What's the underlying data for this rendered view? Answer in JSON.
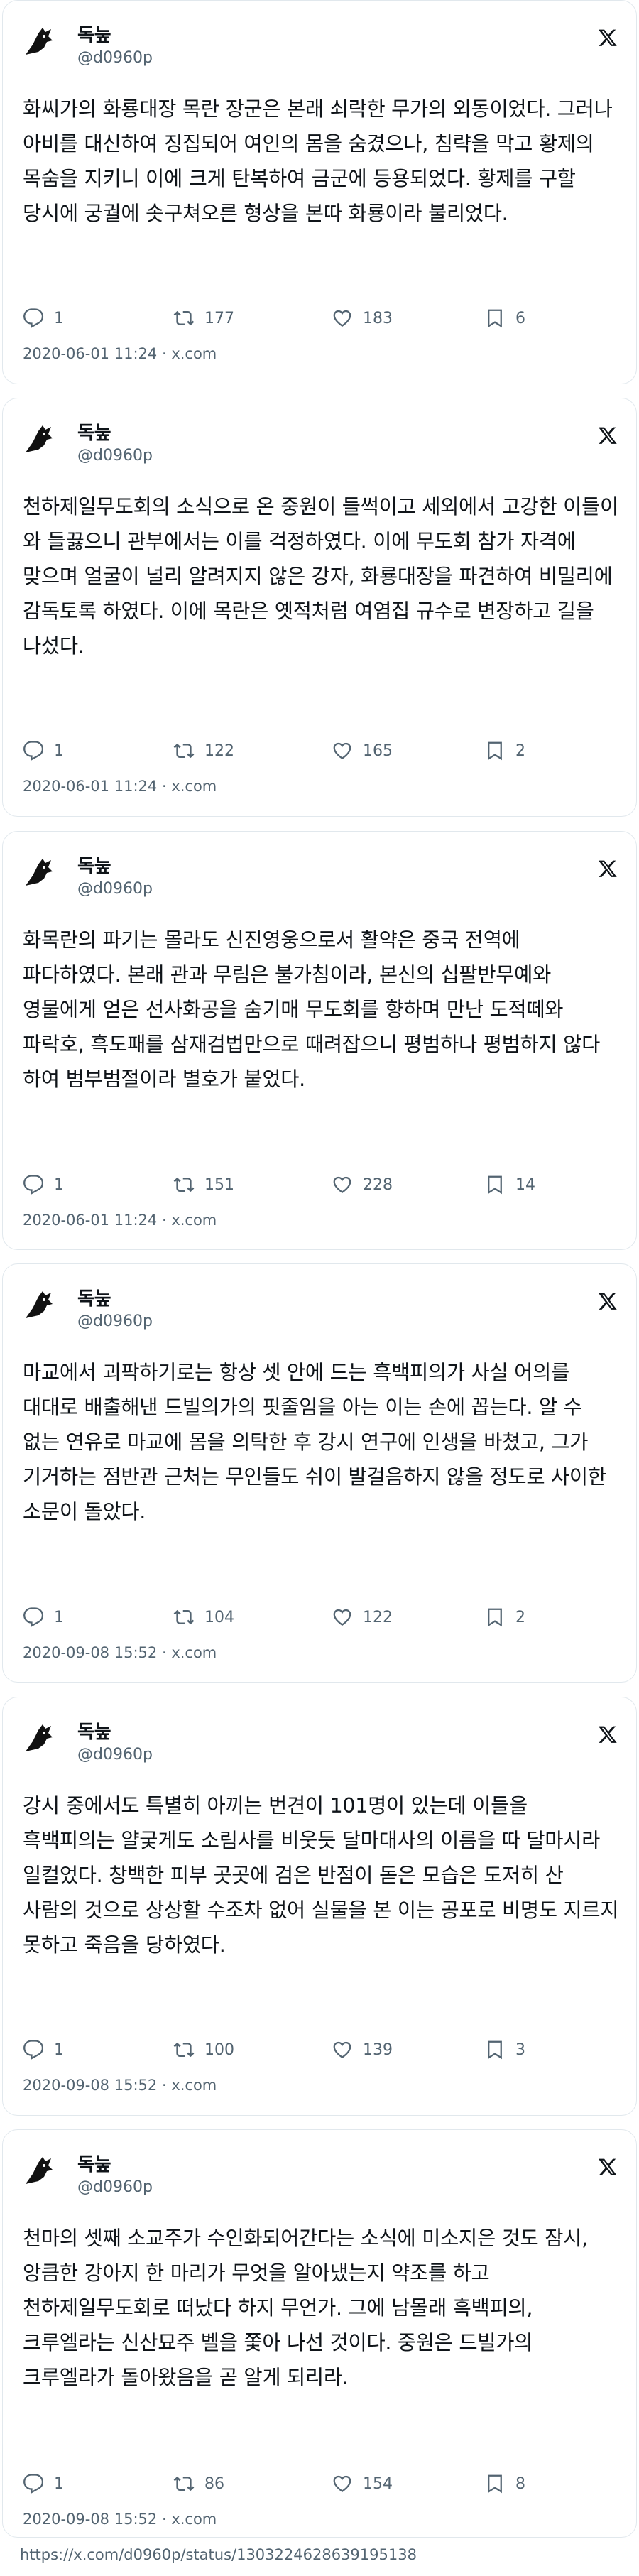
{
  "source": "x.com",
  "separator": "·",
  "tweets": [
    {
      "name": "독눞",
      "handle": "@d0960p",
      "text": "화씨가의 화룡대장 목란 장군은 본래 쇠락한 무가의 외동이었다. 그러나 아비를 대신하여 징집되어 여인의 몸을 숨겼으나, 침략을 막고 황제의 목숨을 지키니 이에 크게 탄복하여 금군에 등용되었다. 황제를 구할 당시에 궁궐에 솟구쳐오른 형상을 본따 화룡이라 불리었다.",
      "replies": "1",
      "retweets": "177",
      "likes": "183",
      "bookmarks": "6",
      "timestamp": "2020-06-01 11:24"
    },
    {
      "name": "독눞",
      "handle": "@d0960p",
      "text": "천하제일무도회의 소식으로 온 중원이 들썩이고 세외에서 고강한 이들이 와 들끓으니 관부에서는 이를 걱정하였다. 이에 무도회 참가 자격에 맞으며 얼굴이 널리 알려지지 않은 강자, 화룡대장을 파견하여 비밀리에 감독토록 하였다. 이에 목란은 옛적처럼 여염집 규수로 변장하고 길을 나섰다.",
      "replies": "1",
      "retweets": "122",
      "likes": "165",
      "bookmarks": "2",
      "timestamp": "2020-06-01 11:24"
    },
    {
      "name": "독눞",
      "handle": "@d0960p",
      "text": "화목란의 파기는 몰라도 신진영웅으로서 활약은 중국 전역에 파다하였다. 본래 관과 무림은 불가침이라, 본신의 십팔반무예와 영물에게 얻은 선사화공을 숨기매 무도회를 향하며 만난 도적떼와 파락호, 흑도패를 삼재검법만으로 때려잡으니 평범하나 평범하지 않다 하여 범부범절이라 별호가 붙었다.",
      "replies": "1",
      "retweets": "151",
      "likes": "228",
      "bookmarks": "14",
      "timestamp": "2020-06-01 11:24"
    },
    {
      "name": "독눞",
      "handle": "@d0960p",
      "text": "마교에서 괴팍하기로는 항상 셋 안에 드는 흑백피의가 사실 어의를 대대로 배출해낸 드빌의가의 핏줄임을 아는 이는 손에 꼽는다. 알 수 없는 연유로 마교에 몸을 의탁한 후 강시 연구에 인생을 바쳤고, 그가 기거하는 점반관 근처는 무인들도 쉬이 발걸음하지 않을 정도로 사이한 소문이 돌았다.",
      "replies": "1",
      "retweets": "104",
      "likes": "122",
      "bookmarks": "2",
      "timestamp": "2020-09-08 15:52"
    },
    {
      "name": "독눞",
      "handle": "@d0960p",
      "text": "강시 중에서도 특별히 아끼는 번견이 101명이 있는데 이들을 흑백피의는 얄궂게도 소림사를 비웃듯 달마대사의 이름을 따 달마시라 일컬었다. 창백한 피부 곳곳에 검은 반점이 돋은 모습은 도저히 산 사람의 것으로 상상할 수조차 없어 실물을 본 이는 공포로 비명도 지르지 못하고 죽음을 당하였다.",
      "replies": "1",
      "retweets": "100",
      "likes": "139",
      "bookmarks": "3",
      "timestamp": "2020-09-08 15:52"
    },
    {
      "name": "독눞",
      "handle": "@d0960p",
      "text": "천마의 셋째 소교주가 수인화되어간다는 소식에 미소지은 것도 잠시, 앙큼한 강아지 한 마리가 무엇을 알아냈는지 약조를 하고 천하제일무도회로 떠났다 하지 무언가. 그에 남몰래 흑백피의, 크루엘라는 신산묘주 벨을 쫓아 나선 것이다. 중원은 드빌가의 크루엘라가 돌아왔음을 곧 알게 되리라.",
      "replies": "1",
      "retweets": "86",
      "likes": "154",
      "bookmarks": "8",
      "timestamp": "2020-09-08 15:52"
    }
  ],
  "footer_url": "https://x.com/d0960p/status/1303224628639195138"
}
